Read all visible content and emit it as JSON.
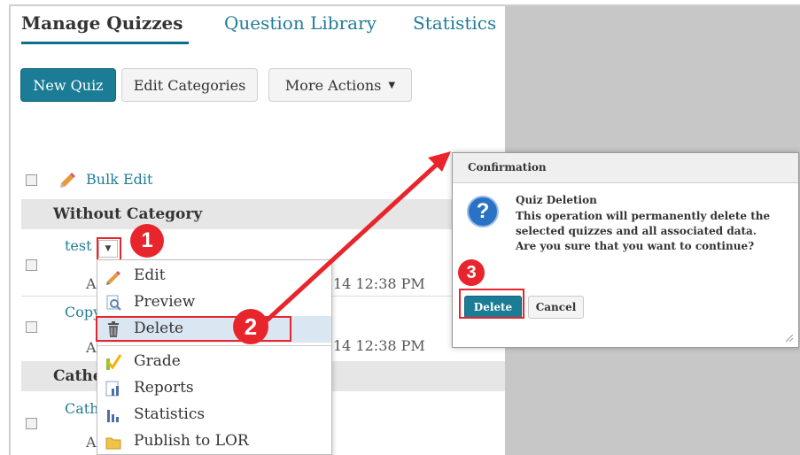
{
  "tabs": {
    "manage": "Manage Quizzes",
    "library": "Question Library",
    "statistics": "Statistics"
  },
  "toolbar": {
    "new_quiz": "New Quiz",
    "edit_categories": "Edit Categories",
    "more_actions": "More Actions",
    "more_actions_caret": "▼"
  },
  "bulk_edit": "Bulk Edit",
  "categories": {
    "without": "Without Category",
    "cathe": "Cathe"
  },
  "quizzes": {
    "test": "test",
    "copy": "Copy",
    "cath": "Cath",
    "ghost_a": "A"
  },
  "dates": {
    "row1": "14 12:38 PM",
    "row2": "14 12:38 PM"
  },
  "menu": {
    "edit": "Edit",
    "preview": "Preview",
    "delete": "Delete",
    "grade": "Grade",
    "reports": "Reports",
    "statistics": "Statistics",
    "publish": "Publish to LOR"
  },
  "badges": {
    "one": "1",
    "two": "2",
    "three": "3"
  },
  "dialog": {
    "header": "Confirmation",
    "title": "Quiz Deletion",
    "line1": "This operation will permanently delete the",
    "line2": "selected quizzes and all associated data.",
    "line3": "Are you sure that you want to continue?",
    "delete": "Delete",
    "cancel": "Cancel",
    "icon_glyph": "?"
  },
  "colors": {
    "accent": "#1b7c96",
    "link": "#217d99",
    "annotation_red": "#e8252c"
  }
}
